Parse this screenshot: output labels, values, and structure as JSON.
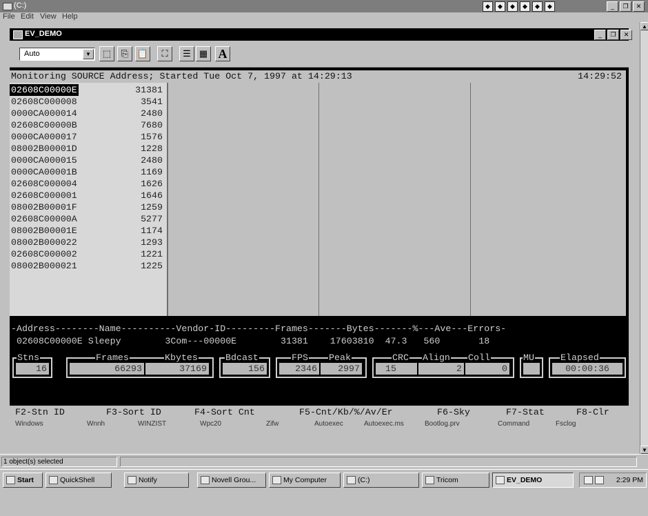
{
  "outer_window": {
    "title": "(C:)",
    "menu": [
      "File",
      "Edit",
      "View",
      "Help"
    ]
  },
  "inner_window": {
    "title": "EV_DEMO",
    "toolbar": {
      "font_select": "Auto",
      "font_button": "A"
    }
  },
  "console": {
    "header_left": "Monitoring SOURCE Address; Started Tue Oct 7, 1997 at 14:29:13",
    "header_right": "14:29:52",
    "rows": [
      {
        "address": "02608C00000E",
        "count": "31381",
        "selected": true
      },
      {
        "address": "02608C000008",
        "count": "3541"
      },
      {
        "address": "0000CA000014",
        "count": "2480"
      },
      {
        "address": "02608C00000B",
        "count": "7680"
      },
      {
        "address": "0000CA000017",
        "count": "1576"
      },
      {
        "address": "08002B00001D",
        "count": "1228"
      },
      {
        "address": "0000CA000015",
        "count": "2480"
      },
      {
        "address": "0000CA00001B",
        "count": "1169"
      },
      {
        "address": "02608C000004",
        "count": "1626"
      },
      {
        "address": "02608C000001",
        "count": "1646"
      },
      {
        "address": "08002B00001F",
        "count": "1259"
      },
      {
        "address": "02608C00000A",
        "count": "5277"
      },
      {
        "address": "08002B00001E",
        "count": "1174"
      },
      {
        "address": "08002B000022",
        "count": "1293"
      },
      {
        "address": "02608C000002",
        "count": "1221"
      },
      {
        "address": "08002B000021",
        "count": "1225"
      }
    ],
    "detail_header": "-Address--------Name----------Vendor-ID---------Frames-------Bytes-------%---Ave---Errors-",
    "detail_values": " 02608C00000E Sleepy        3Com---00000E        31381    17603810  47.3   560       18",
    "stats": {
      "stns_label": "Stns",
      "stns": "16",
      "frames_label": "Frames",
      "kbytes_label": "Kbytes",
      "frames": "66293",
      "kbytes": "37169",
      "bdcast_label": "Bdcast",
      "bdcast": "156",
      "fps_label": "FPS",
      "peak_label": "Peak",
      "fps": "2346",
      "peak": "2997",
      "crc_label": "CRC",
      "align_label": "Align",
      "coll_label": "Coll",
      "crc": "15",
      "align": "2",
      "coll": "0",
      "mu_label": "MU",
      "mu": "",
      "elapsed_label": "Elapsed",
      "elapsed": "00:00:36"
    },
    "function_keys": [
      "F2-Stn ID",
      "F3-Sort ID",
      "F4-Sort Cnt",
      "F5-Cnt/Kb/%/Av/Er",
      "F6-Sky",
      "F7-Stat",
      "F8-Clr"
    ]
  },
  "desktop_icon_labels": [
    "Windows",
    "Wnnh",
    "WINZIST",
    "Wpc20",
    "Zifw",
    "Autoexec",
    "Autoexec.ms",
    "Bootlog.prv",
    "Command",
    "Fsclog"
  ],
  "status_bar": {
    "text": "1 object(s) selected"
  },
  "taskbar": {
    "start": "Start",
    "buttons": [
      "QuickShell",
      "Notify",
      "Novell Grou...",
      "My Computer",
      "(C:)",
      "Tricom",
      "EV_DEMO"
    ],
    "active": "EV_DEMO",
    "clock": "2:29 PM"
  }
}
